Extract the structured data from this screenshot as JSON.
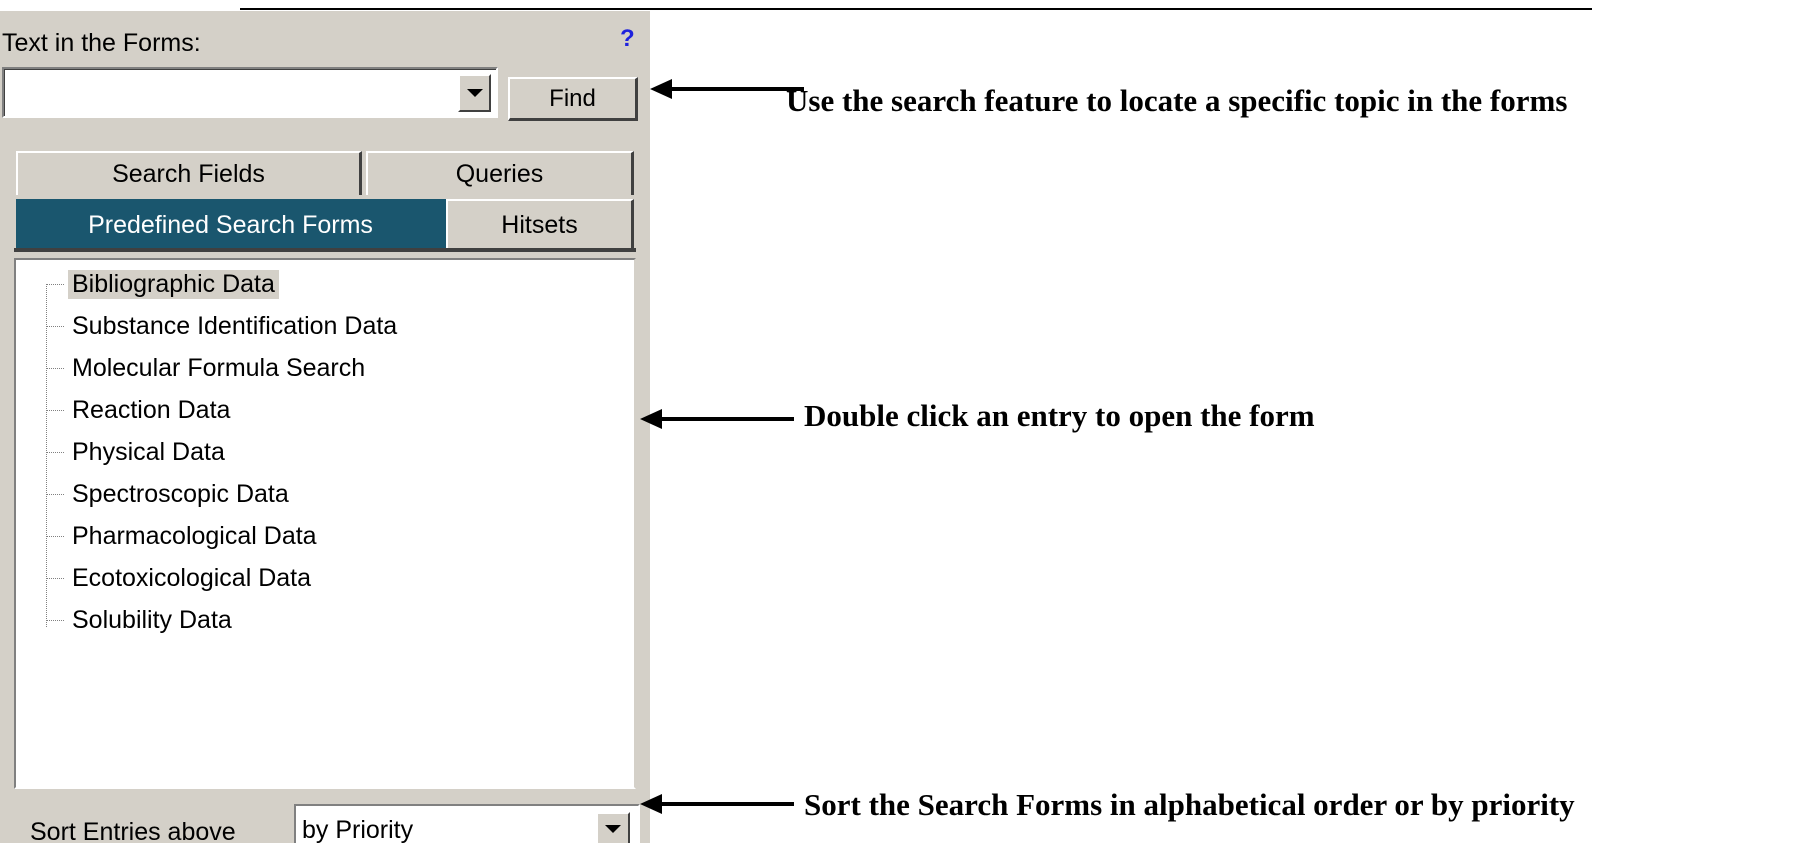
{
  "panel": {
    "search_label": "Text in the Forms:",
    "help_glyph": "?",
    "search_input": {
      "value": "",
      "placeholder": ""
    },
    "find_label": "Find",
    "tabs": {
      "search_fields": "Search Fields",
      "queries": "Queries",
      "predefined_search_forms": "Predefined Search Forms",
      "hitsets": "Hitsets"
    },
    "tree_items": [
      "Bibliographic Data",
      "Substance Identification Data",
      "Molecular Formula Search",
      "Reaction Data",
      "Physical Data",
      "Spectroscopic Data",
      "Pharmacological Data",
      "Ecotoxicological Data",
      "Solubility Data"
    ],
    "sort_label": "Sort Entries above",
    "sort_value": "by Priority"
  },
  "annotations": {
    "search": "Use the search feature to locate a specific topic in the forms",
    "double_click": "Double click an entry to open the form",
    "sort": "Sort the Search Forms in alphabetical order or by priority"
  },
  "colors": {
    "panel_bg": "#d4d0c8",
    "active_tab_bg": "#1a566e",
    "help_icon": "#1e22dd"
  }
}
